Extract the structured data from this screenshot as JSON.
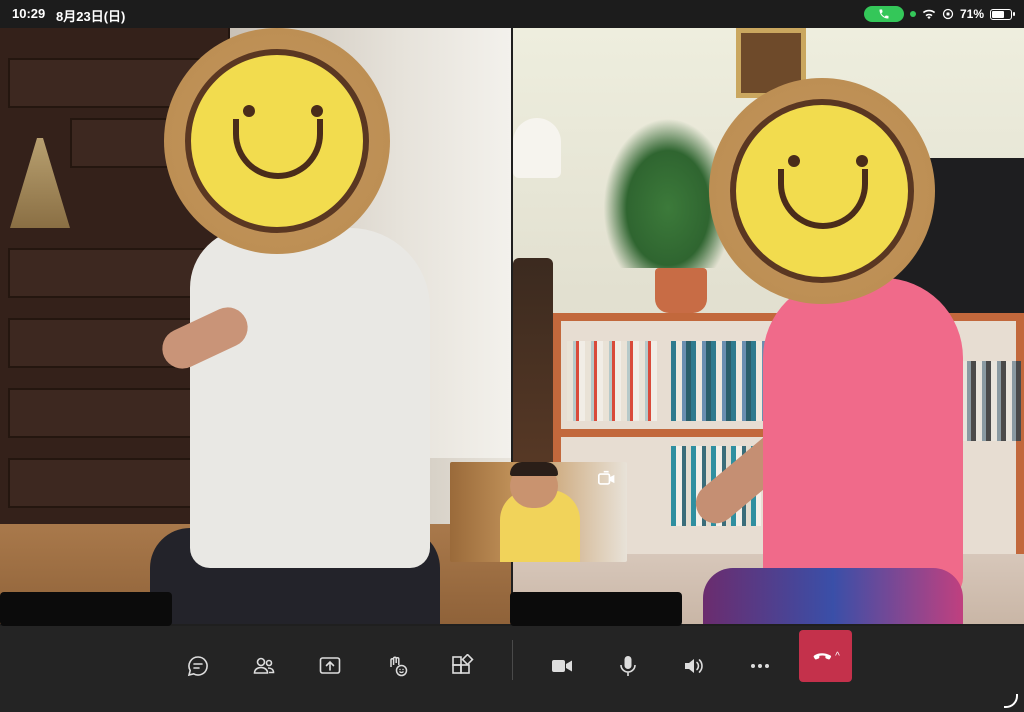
{
  "status_bar": {
    "time": "10:29",
    "date": "8月23日(日)",
    "battery_text": "71%",
    "battery_level": 0.71,
    "call_indicator_color": "#34c759"
  },
  "participants": [
    {
      "tile": "left",
      "name_redacted": true,
      "face_cover": "smiley-sticker"
    },
    {
      "tile": "right",
      "name_redacted": true,
      "face_cover": "smiley-sticker"
    }
  ],
  "self_preview": {
    "switch_camera_icon": "camera-switch-icon"
  },
  "toolbar": {
    "buttons": [
      {
        "name": "chat",
        "icon": "chat-bubble-icon"
      },
      {
        "name": "people",
        "icon": "people-icon"
      },
      {
        "name": "share",
        "icon": "share-screen-icon"
      },
      {
        "name": "reactions",
        "icon": "raise-hand-icon"
      },
      {
        "name": "apps",
        "icon": "apps-icon"
      },
      {
        "name": "camera",
        "icon": "video-camera-icon"
      },
      {
        "name": "mic",
        "icon": "microphone-icon"
      },
      {
        "name": "speaker",
        "icon": "speaker-icon"
      },
      {
        "name": "more",
        "icon": "more-icon"
      }
    ],
    "hangup": {
      "icon": "phone-hangup-icon",
      "color": "#c4314b"
    }
  }
}
